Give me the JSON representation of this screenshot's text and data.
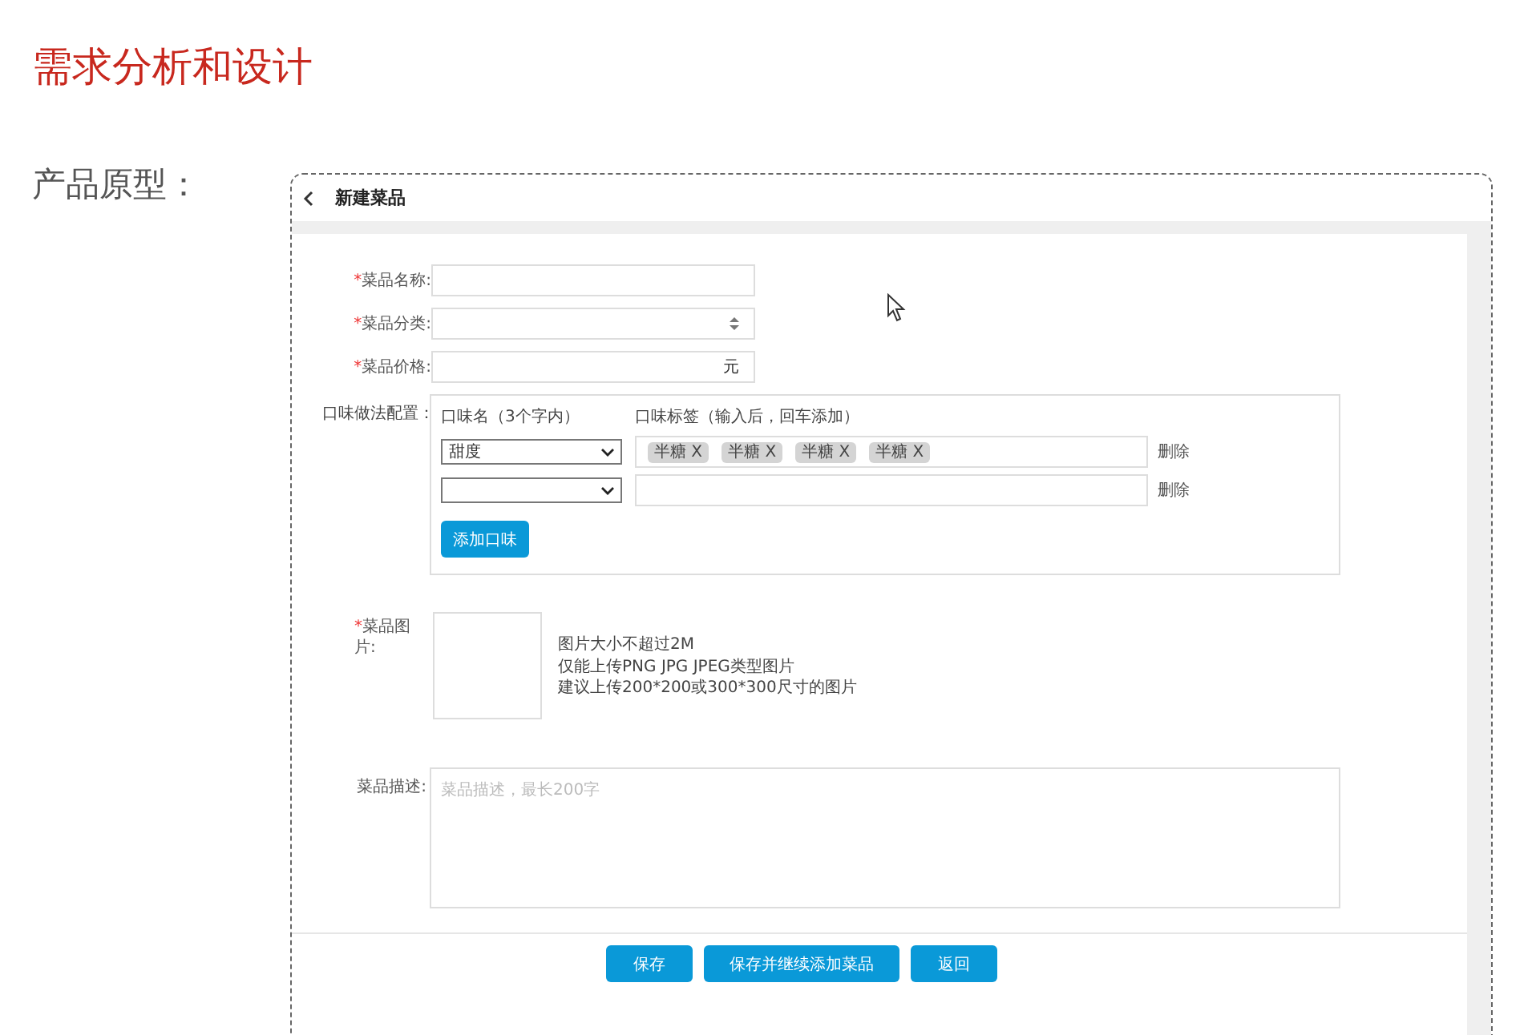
{
  "heading": "需求分析和设计",
  "section_label": "产品原型：",
  "prototype": {
    "title": "新建菜品",
    "fields": [
      {
        "mark": "*",
        "label": "菜品名称:",
        "kind": "text"
      },
      {
        "mark": "*",
        "label": "菜品分类:",
        "kind": "select"
      },
      {
        "mark": "*",
        "label": "菜品价格:",
        "kind": "price",
        "suffix": "元"
      }
    ],
    "flavors": {
      "label": "口味做法配置：",
      "name_header": "口味名（3个字内）",
      "tags_header": "口味标签（输入后，回车添加）",
      "rows": [
        {
          "name": "甜度",
          "tags": [
            {
              "text": "半糖 X"
            },
            {
              "text": "半糖 X"
            },
            {
              "text": "半糖 X"
            },
            {
              "text": "半糖 X"
            }
          ],
          "delete": "删除"
        },
        {
          "delete": "删除"
        }
      ],
      "add_button": "添加口味"
    },
    "image": {
      "mark": "*",
      "label": "菜品图片:",
      "hints": [
        "图片大小不超过2M",
        "仅能上传PNG JPG JPEG类型图片",
        "建议上传200*200或300*300尺寸的图片"
      ]
    },
    "description": {
      "label": "菜品描述:",
      "placeholder": "菜品描述，最长200字"
    },
    "buttons": [
      "保存",
      "保存并继续添加菜品",
      "返回"
    ]
  }
}
